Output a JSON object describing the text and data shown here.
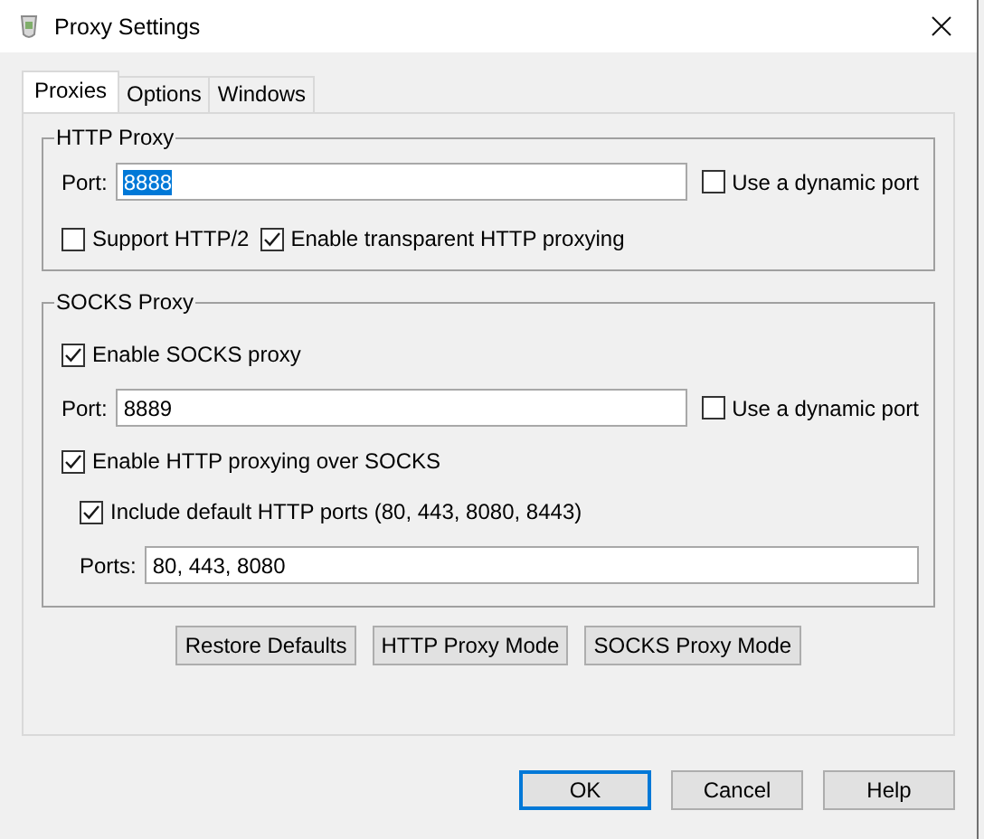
{
  "window": {
    "title": "Proxy Settings"
  },
  "tabs": [
    {
      "label": "Proxies",
      "selected": true
    },
    {
      "label": "Options",
      "selected": false
    },
    {
      "label": "Windows",
      "selected": false
    }
  ],
  "http_proxy": {
    "title": "HTTP Proxy",
    "port": {
      "label": "Port:",
      "value": "8888",
      "value_selected": true
    },
    "dynamic_port": {
      "label": "Use a dynamic port",
      "checked": false
    },
    "options": [
      {
        "label": "Support HTTP/2",
        "checked": false
      },
      {
        "label": "Enable transparent HTTP proxying",
        "checked": true
      }
    ]
  },
  "socks_proxy": {
    "title": "SOCKS Proxy",
    "enable": {
      "label": "Enable SOCKS proxy",
      "checked": true
    },
    "port": {
      "label": "Port:",
      "value": "8889",
      "value_selected": false
    },
    "dynamic_port": {
      "label": "Use a dynamic port",
      "checked": false
    },
    "http_over_socks": {
      "label": "Enable HTTP proxying over SOCKS",
      "checked": true
    },
    "include_default_ports": {
      "label": "Include default HTTP ports (80, 443, 8080, 8443)",
      "checked": true
    },
    "ports": {
      "label": "Ports:",
      "value": "80, 443, 8080",
      "value_selected": false
    }
  },
  "panel_buttons": [
    {
      "label": "Restore Defaults",
      "default": false
    },
    {
      "label": "HTTP Proxy Mode",
      "default": false
    },
    {
      "label": "SOCKS Proxy Mode",
      "default": false
    }
  ],
  "dialog_buttons": [
    {
      "label": "OK",
      "default": true
    },
    {
      "label": "Cancel",
      "default": false
    },
    {
      "label": "Help",
      "default": false
    }
  ]
}
